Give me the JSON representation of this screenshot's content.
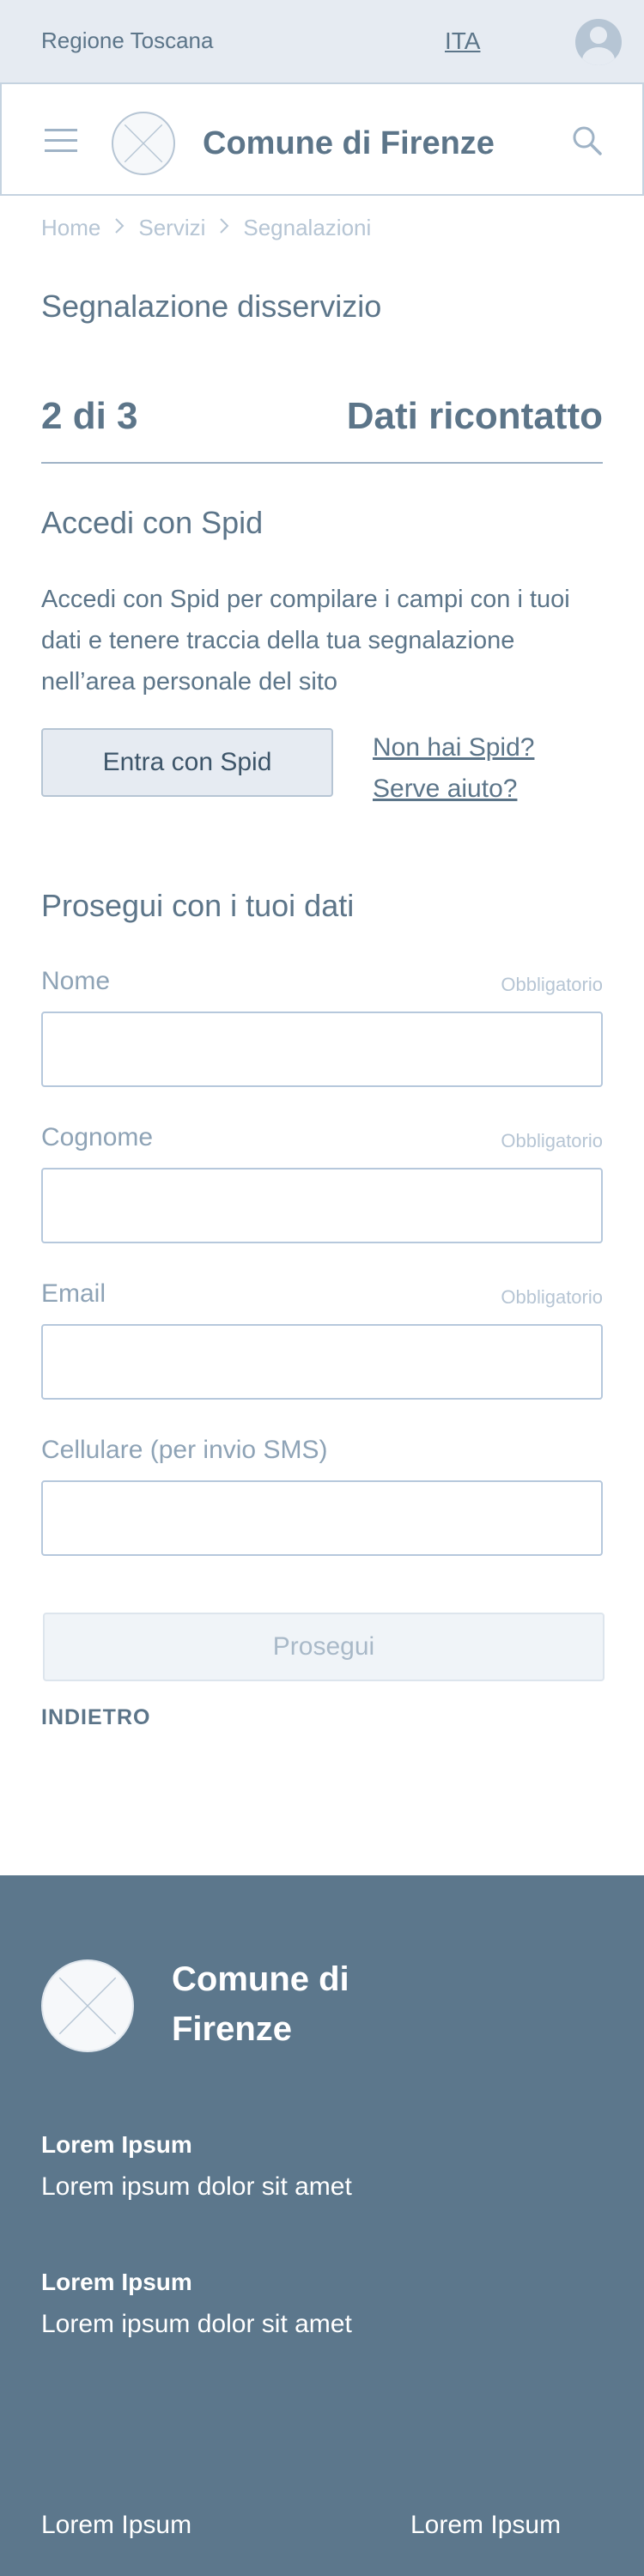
{
  "topbar": {
    "region": "Regione Toscana",
    "language": "ITA",
    "avatar_icon": "user-avatar-icon"
  },
  "header": {
    "menu_icon": "hamburger-menu-icon",
    "site_title": "Comune di Firenze",
    "search_icon": "search-icon"
  },
  "breadcrumb": {
    "items": [
      "Home",
      "Servizi",
      "Segnalazioni"
    ],
    "separator": ">"
  },
  "page": {
    "title": "Segnalazione disservizio",
    "step": {
      "current": "2 di 3",
      "label": "Dati ricontatto"
    }
  },
  "spid": {
    "title": "Accedi con Spid",
    "description": "Accedi con Spid per compilare i campi con i tuoi dati e tenere traccia della tua segnalazione nell’area personale del sito",
    "button_label": "Entra con Spid",
    "link_no_spid": "Non hai Spid?",
    "link_help": "Serve aiuto?"
  },
  "form": {
    "title": "Prosegui con i tuoi dati",
    "fields": [
      {
        "label": "Nome",
        "required": "Obbligatorio",
        "value": ""
      },
      {
        "label": "Cognome",
        "required": "Obbligatorio",
        "value": ""
      },
      {
        "label": "Email",
        "required": "Obbligatorio",
        "value": ""
      },
      {
        "label": "Cellulare (per invio SMS)",
        "required": "",
        "value": ""
      }
    ],
    "submit_label": "Prosegui",
    "back_label": "INDIETRO"
  },
  "footer": {
    "site_title": "Comune di Firenze",
    "blocks": [
      {
        "title": "Lorem Ipsum",
        "text": "Lorem ipsum dolor sit amet"
      },
      {
        "title": "Lorem Ipsum",
        "text": "Lorem ipsum dolor sit amet"
      }
    ],
    "bottom_links": [
      "Lorem Ipsum",
      "Lorem Ipsum"
    ]
  },
  "colors": {
    "primary": "#5c7589",
    "topbar_bg": "#e6ebf2",
    "footer_bg": "#5c778c",
    "muted": "#b6c5d4"
  }
}
